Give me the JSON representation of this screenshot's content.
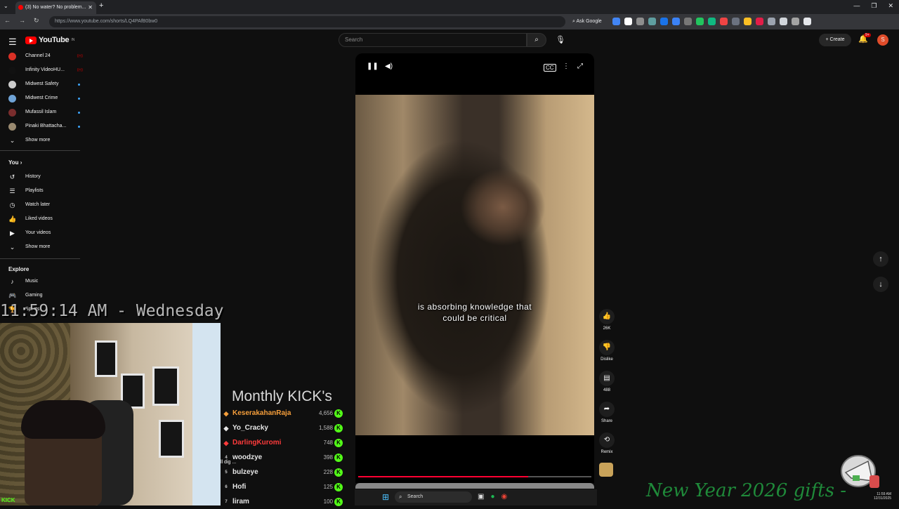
{
  "browser": {
    "tab_title": "(3) No water? No problem...",
    "url": "https://www.youtube.com/shorts/LQ4PAfB0bw0",
    "ask_google": "Ask Google",
    "extension_colors": [
      "#4285f4",
      "#ffffff",
      "#8e8e8e",
      "#5f9ea0",
      "#1a73e8",
      "#3b82f6",
      "#777",
      "#22c55e",
      "#10b981",
      "#ef4444",
      "#6b7280",
      "#fbbf24",
      "#e11d48",
      "#9ca3af",
      "#d1d5db",
      "#a3a3a3",
      "#e5e7eb"
    ]
  },
  "youtube": {
    "logo_text": "YouTube",
    "logo_region": "IN",
    "search_placeholder": "Search",
    "create_label": "Create",
    "notif_count": "9+",
    "avatar_letter": "S"
  },
  "sidebar": {
    "subscriptions": [
      {
        "label": "Channel 24",
        "color": "#d93025",
        "status": "live"
      },
      {
        "label": "Infinity VideoHU...",
        "color": "#111111",
        "status": "live"
      },
      {
        "label": "Midwest Safety",
        "color": "#cccccc",
        "status": "new"
      },
      {
        "label": "Midwest Crime",
        "color": "#6fa3d6",
        "status": "new"
      },
      {
        "label": "Mufassil Islam",
        "color": "#7a2d2d",
        "status": "new"
      },
      {
        "label": "Pinaki Bhattacha...",
        "color": "#9a8a70",
        "status": "new"
      }
    ],
    "show_more_1": "Show more",
    "you_label": "You",
    "you_items": [
      {
        "label": "History",
        "icon": "↺"
      },
      {
        "label": "Playlists",
        "icon": "☰"
      },
      {
        "label": "Watch later",
        "icon": "◷"
      },
      {
        "label": "Liked videos",
        "icon": "👍"
      },
      {
        "label": "Your videos",
        "icon": "▶"
      }
    ],
    "show_more_2": "Show more",
    "explore_label": "Explore",
    "explore_items": [
      {
        "label": "Music",
        "icon": "♪"
      },
      {
        "label": "Gaming",
        "icon": "🎮"
      },
      {
        "label": "Sports",
        "icon": "🏆"
      }
    ]
  },
  "overlay": {
    "clock": "11:59:14 AM - Wednesday",
    "kick_logo": "KICK",
    "kick_title": "Monthly KICK's",
    "ill_dig": "ll dig ...",
    "new_year": "New Year 2026 gifts -",
    "sys_time_1": "11:59 AM",
    "sys_time_2": "12/31/2025"
  },
  "leaderboard": [
    {
      "rank": "",
      "name": "KeserakahanRaja",
      "count": "4,656",
      "color": "#f59e3b",
      "badge": "◆"
    },
    {
      "rank": "",
      "name": "Yo_Cracky",
      "count": "1,588",
      "color": "#e6e6e6",
      "badge": "◆"
    },
    {
      "rank": "",
      "name": "DarlingKuromi",
      "count": "748",
      "color": "#ff3b3b",
      "badge": "◆"
    },
    {
      "rank": "4",
      "name": "woodzye",
      "count": "398",
      "color": "#e6e6e6",
      "badge": ""
    },
    {
      "rank": "5",
      "name": "bulzeye",
      "count": "228",
      "color": "#e6e6e6",
      "badge": ""
    },
    {
      "rank": "6",
      "name": "Hofi",
      "count": "125",
      "color": "#e6e6e6",
      "badge": ""
    },
    {
      "rank": "7",
      "name": "liram",
      "count": "100",
      "color": "#e6e6e6",
      "badge": ""
    }
  ],
  "player": {
    "caption_line1": "is absorbing knowledge that",
    "caption_line2": "could be critical",
    "progress": 0.73
  },
  "actions": {
    "like_count": "26K",
    "dislike_label": "Dislike",
    "comment_count": "488",
    "share_label": "Share",
    "remix_label": "Remix"
  },
  "taskbar": {
    "search_label": "Search"
  }
}
